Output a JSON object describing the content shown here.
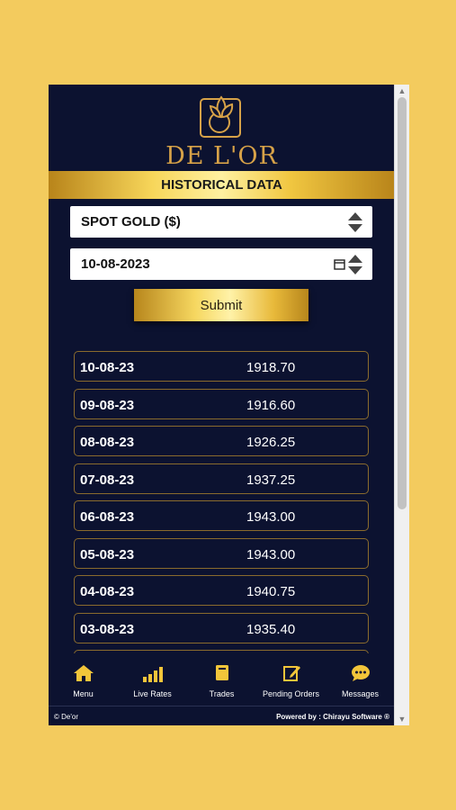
{
  "brand": {
    "name": "DE L'OR",
    "logo_icon": "gold-leaf-logo"
  },
  "page": {
    "title": "HISTORICAL DATA"
  },
  "form": {
    "metal_select_value": "SPOT GOLD ($)",
    "date_value": "10-08-2023",
    "submit_label": "Submit"
  },
  "rates": [
    {
      "date": "10-08-23",
      "price": "1918.70"
    },
    {
      "date": "09-08-23",
      "price": "1916.60"
    },
    {
      "date": "08-08-23",
      "price": "1926.25"
    },
    {
      "date": "07-08-23",
      "price": "1937.25"
    },
    {
      "date": "06-08-23",
      "price": "1943.00"
    },
    {
      "date": "05-08-23",
      "price": "1943.00"
    },
    {
      "date": "04-08-23",
      "price": "1940.75"
    },
    {
      "date": "03-08-23",
      "price": "1935.40"
    }
  ],
  "nav": [
    {
      "label": "Menu",
      "icon": "home-icon"
    },
    {
      "label": "Live Rates",
      "icon": "bar-chart-icon"
    },
    {
      "label": "Trades",
      "icon": "book-icon"
    },
    {
      "label": "Pending Orders",
      "icon": "edit-icon"
    },
    {
      "label": "Messages",
      "icon": "chat-icon"
    }
  ],
  "footer": {
    "copyright": "© De'or",
    "powered": "Powered by : Chirayu Software ®"
  },
  "colors": {
    "background": "#f3cb5e",
    "app_bg": "#0c1230",
    "gold": "#d7a248",
    "accent": "#f2c53a"
  }
}
